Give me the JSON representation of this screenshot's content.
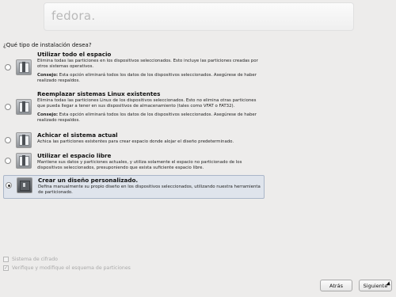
{
  "banner": {
    "logo": "fedora."
  },
  "question": "¿Qué tipo de instalación desea?",
  "options": [
    {
      "title": "Utilizar todo el espacio",
      "desc": "Elimina todas las particiones en los dispositivos seleccionados. Esto incluye las particiones creadas por otros sistemas operativos.",
      "tip_label": "Consejo:",
      "tip": "Esta opción eliminará todos los datos de los dispositivos seleccionados. Asegúrese de haber realizado respaldos.",
      "selected": false
    },
    {
      "title": "Reemplazar sistemas Linux existentes",
      "desc": "Elimina todas las particiones Linux de los dispositivos seleccionados. Esto no elimina otras particiones que pueda llegar a tener en sus dispositivos de almacenamiento (tales como VFAT o FAT32).",
      "tip_label": "Consejo:",
      "tip": "Esta opción eliminará todos los datos de los dispositivos seleccionados. Asegúrese de haber realizado respaldos.",
      "selected": false
    },
    {
      "title": "Achicar el sistema actual",
      "desc": "Achica las particiones existentes para crear espacio donde alojar el diseño predeterminado.",
      "selected": false
    },
    {
      "title": "Utilizar el espacio libre",
      "desc": "Mantiene sus datos y particiones actuales, y utiliza solamente el espacio no particionado de los dispositivos seleccionados, presuponiendo que exista suficiente espacio libre.",
      "selected": false
    },
    {
      "title": "Crear un diseño personalizado.",
      "desc": "Defina manualmente su propio diseño en los dispositivos seleccionados, utilizando nuestra herramienta de particionado.",
      "selected": true
    }
  ],
  "checkboxes": {
    "encrypt": "Sistema de cifrado",
    "review": "Verifique y modifique el esquema de particiones"
  },
  "buttons": {
    "back": "Atrás",
    "next": "Siguiente"
  }
}
